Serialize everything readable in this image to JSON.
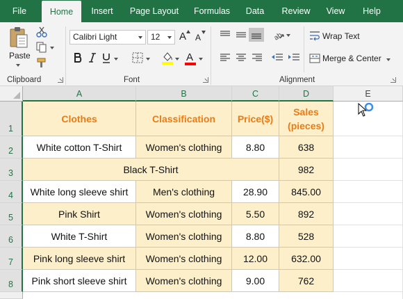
{
  "tabs": [
    {
      "label": "File",
      "active": false
    },
    {
      "label": "Home",
      "active": true
    },
    {
      "label": "Insert",
      "active": false
    },
    {
      "label": "Page Layout",
      "active": false
    },
    {
      "label": "Formulas",
      "active": false
    },
    {
      "label": "Data",
      "active": false
    },
    {
      "label": "Review",
      "active": false
    },
    {
      "label": "View",
      "active": false
    },
    {
      "label": "Help",
      "active": false
    }
  ],
  "ribbon": {
    "clipboard": {
      "label": "Clipboard",
      "paste_label": "Paste"
    },
    "font": {
      "label": "Font",
      "font_name": "Calibri Light",
      "font_size": "12",
      "grow_label": "A",
      "shrink_label": "A",
      "font_color_label": "A"
    },
    "alignment": {
      "label": "Alignment",
      "wrap_text_label": "Wrap Text",
      "merge_center_label": "Merge & Center"
    }
  },
  "sheet": {
    "columns": [
      "A",
      "B",
      "C",
      "D",
      "E"
    ],
    "rows": [
      "1",
      "2",
      "3",
      "4",
      "5",
      "6",
      "7",
      "8"
    ],
    "header": {
      "clothes": "Clothes",
      "classification": "Classification",
      "price": "Price($)",
      "sales_line1": "Sales",
      "sales_line2": "(pieces)"
    },
    "data": [
      {
        "clothes": "White cotton T-Shirt",
        "classification": "Women's clothing",
        "price": "8.80",
        "sales": "638"
      },
      {
        "merged": "Black T-Shirt",
        "sales": "982"
      },
      {
        "clothes": "White long sleeve shirt",
        "classification": "Men's clothing",
        "price": "28.90",
        "sales": "845.00"
      },
      {
        "clothes": "Pink Shirt",
        "classification": "Women's clothing",
        "price": "5.50",
        "sales": "892"
      },
      {
        "clothes": "White T-Shirt",
        "classification": "Women's clothing",
        "price": "8.80",
        "sales": "528"
      },
      {
        "clothes": "Pink long sleeve shirt",
        "classification": "Women's clothing",
        "price": "12.00",
        "sales": "632.00"
      },
      {
        "clothes": "Pink short sleeve shirt",
        "classification": "Women's clothing",
        "price": "9.00",
        "sales": "762"
      }
    ]
  },
  "colors": {
    "accent": "#217346",
    "header_text": "#ea7b15",
    "highlight_fill": "#fdefc9",
    "highlight_border": "#f4c65e"
  }
}
